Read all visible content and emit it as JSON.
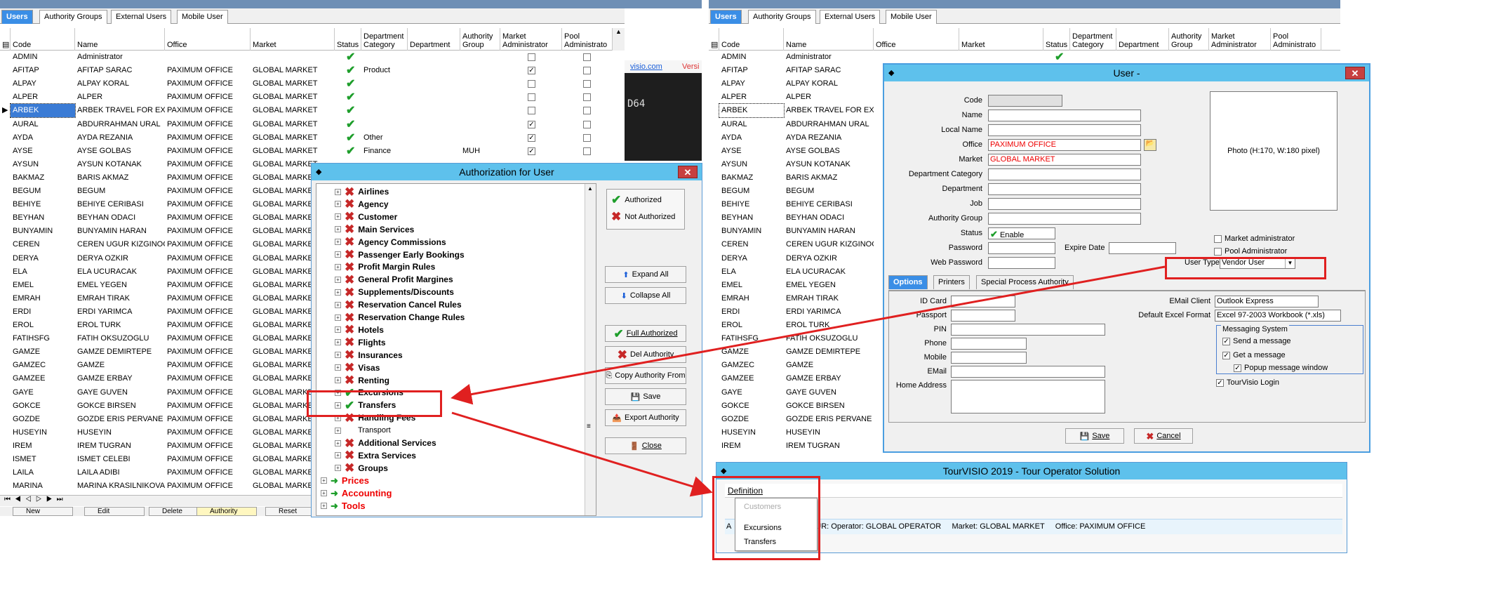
{
  "left_grid": {
    "tabs": [
      "Users",
      "Authority Groups",
      "External Users",
      "Mobile User"
    ],
    "columns": [
      "Code",
      "Name",
      "Office",
      "Market",
      "Status",
      "Department Category",
      "Department",
      "Authority Group",
      "Market Administrator",
      "Pool Administrato"
    ],
    "rows": [
      {
        "code": "ADMIN",
        "name": "Administrator",
        "office": "",
        "market": "",
        "status": true,
        "dept_cat": "",
        "auth_group": "",
        "market_admin": false,
        "pool_admin": false
      },
      {
        "code": "AFITAP",
        "name": "AFITAP SARAC",
        "office": "PAXIMUM OFFICE",
        "market": "GLOBAL MARKET",
        "status": true,
        "dept_cat": "Product",
        "auth_group": "",
        "market_admin": true,
        "pool_admin": false
      },
      {
        "code": "ALPAY",
        "name": "ALPAY KORAL",
        "office": "PAXIMUM OFFICE",
        "market": "GLOBAL MARKET",
        "status": true,
        "dept_cat": "",
        "auth_group": "",
        "market_admin": false,
        "pool_admin": false
      },
      {
        "code": "ALPER",
        "name": "ALPER",
        "office": "PAXIMUM OFFICE",
        "market": "GLOBAL MARKET",
        "status": true,
        "dept_cat": "",
        "auth_group": "",
        "market_admin": false,
        "pool_admin": false
      },
      {
        "code": "ARBEK",
        "name": "ARBEK TRAVEL FOR EXCU",
        "office": "PAXIMUM OFFICE",
        "market": "GLOBAL MARKET",
        "status": true,
        "dept_cat": "",
        "auth_group": "",
        "market_admin": false,
        "pool_admin": false
      },
      {
        "code": "AURAL",
        "name": "ABDURRAHMAN URAL",
        "office": "PAXIMUM OFFICE",
        "market": "GLOBAL MARKET",
        "status": true,
        "dept_cat": "",
        "auth_group": "",
        "market_admin": true,
        "pool_admin": false
      },
      {
        "code": "AYDA",
        "name": "AYDA REZANIA",
        "office": "PAXIMUM OFFICE",
        "market": "GLOBAL MARKET",
        "status": true,
        "dept_cat": "Other",
        "auth_group": "",
        "market_admin": true,
        "pool_admin": false
      },
      {
        "code": "AYSE",
        "name": "AYSE GOLBAS",
        "office": "PAXIMUM OFFICE",
        "market": "GLOBAL MARKET",
        "status": true,
        "dept_cat": "Finance",
        "auth_group": "MUH",
        "market_admin": true,
        "pool_admin": false
      },
      {
        "code": "AYSUN",
        "name": "AYSUN KOTANAK",
        "office": "PAXIMUM OFFICE",
        "market": "GLOBAL MARKET"
      },
      {
        "code": "BAKMAZ",
        "name": "BARIS AKMAZ",
        "office": "PAXIMUM OFFICE",
        "market": "GLOBAL MARKET"
      },
      {
        "code": "BEGUM",
        "name": "BEGUM",
        "office": "PAXIMUM OFFICE",
        "market": "GLOBAL MARKET"
      },
      {
        "code": "BEHIYE",
        "name": "BEHIYE CERIBASI",
        "office": "PAXIMUM OFFICE",
        "market": "GLOBAL MARKET"
      },
      {
        "code": "BEYHAN",
        "name": "BEYHAN ODACI",
        "office": "PAXIMUM OFFICE",
        "market": "GLOBAL MARKET"
      },
      {
        "code": "BUNYAMIN",
        "name": "BUNYAMIN HARAN",
        "office": "PAXIMUM OFFICE",
        "market": "GLOBAL MARKET"
      },
      {
        "code": "CEREN",
        "name": "CEREN UGUR KIZGINOGLU",
        "office": "PAXIMUM OFFICE",
        "market": "GLOBAL MARKET"
      },
      {
        "code": "DERYA",
        "name": "DERYA OZKIR",
        "office": "PAXIMUM OFFICE",
        "market": "GLOBAL MARKET"
      },
      {
        "code": "ELA",
        "name": "ELA UCURACAK",
        "office": "PAXIMUM OFFICE",
        "market": "GLOBAL MARKET"
      },
      {
        "code": "EMEL",
        "name": "EMEL YEGEN",
        "office": "PAXIMUM OFFICE",
        "market": "GLOBAL MARKET"
      },
      {
        "code": "EMRAH",
        "name": "EMRAH TIRAK",
        "office": "PAXIMUM OFFICE",
        "market": "GLOBAL MARKET"
      },
      {
        "code": "ERDI",
        "name": "ERDI YARIMCA",
        "office": "PAXIMUM OFFICE",
        "market": "GLOBAL MARKET"
      },
      {
        "code": "EROL",
        "name": "EROL TURK",
        "office": "PAXIMUM OFFICE",
        "market": "GLOBAL MARKET"
      },
      {
        "code": "FATIHSFG",
        "name": "FATIH OKSUZOGLU",
        "office": "PAXIMUM OFFICE",
        "market": "GLOBAL MARKET"
      },
      {
        "code": "GAMZE",
        "name": "GAMZE DEMIRTEPE",
        "office": "PAXIMUM OFFICE",
        "market": "GLOBAL MARKET"
      },
      {
        "code": "GAMZEC",
        "name": "GAMZE",
        "office": "PAXIMUM OFFICE",
        "market": "GLOBAL MARKET"
      },
      {
        "code": "GAMZEE",
        "name": "GAMZE ERBAY",
        "office": "PAXIMUM OFFICE",
        "market": "GLOBAL MARKET"
      },
      {
        "code": "GAYE",
        "name": "GAYE GUVEN",
        "office": "PAXIMUM OFFICE",
        "market": "GLOBAL MARKET"
      },
      {
        "code": "GOKCE",
        "name": "GOKCE BIRSEN",
        "office": "PAXIMUM OFFICE",
        "market": "GLOBAL MARKET"
      },
      {
        "code": "GOZDE",
        "name": "GOZDE ERIS PERVANE",
        "office": "PAXIMUM OFFICE",
        "market": "GLOBAL MARKET"
      },
      {
        "code": "HUSEYIN",
        "name": "HUSEYIN",
        "office": "PAXIMUM OFFICE",
        "market": "GLOBAL MARKET"
      },
      {
        "code": "IREM",
        "name": "IREM TUGRAN",
        "office": "PAXIMUM OFFICE",
        "market": "GLOBAL MARKET"
      },
      {
        "code": "ISMET",
        "name": "ISMET CELEBI",
        "office": "PAXIMUM OFFICE",
        "market": "GLOBAL MARKET"
      },
      {
        "code": "LAILA",
        "name": "LAILA ADIBI",
        "office": "PAXIMUM OFFICE",
        "market": "GLOBAL MARKET"
      },
      {
        "code": "MARINA",
        "name": "MARINA KRASILNIKOVA",
        "office": "PAXIMUM OFFICE",
        "market": "GLOBAL MARKET"
      }
    ],
    "bottom_buttons": [
      "New",
      "Edit",
      "Delete",
      "Authority",
      "Reset"
    ]
  },
  "background_bits": {
    "link_text": "visio.com",
    "version_text": "Versi",
    "console_text": "D64"
  },
  "auth_dialog": {
    "title": "Authorization for User",
    "items": [
      {
        "label": "Airlines",
        "state": "x"
      },
      {
        "label": "Agency",
        "state": "x"
      },
      {
        "label": "Customer",
        "state": "x"
      },
      {
        "label": "Main Services",
        "state": "x"
      },
      {
        "label": "Agency Commissions",
        "state": "x"
      },
      {
        "label": "Passenger Early Bookings",
        "state": "x"
      },
      {
        "label": "Profit Margin Rules",
        "state": "x"
      },
      {
        "label": "General Profit Margines",
        "state": "x"
      },
      {
        "label": "Supplements/Discounts",
        "state": "x"
      },
      {
        "label": "Reservation Cancel Rules",
        "state": "x"
      },
      {
        "label": "Reservation Change Rules",
        "state": "x"
      },
      {
        "label": "Hotels",
        "state": "x"
      },
      {
        "label": "Flights",
        "state": "x"
      },
      {
        "label": "Insurances",
        "state": "x"
      },
      {
        "label": "Visas",
        "state": "x"
      },
      {
        "label": "Renting",
        "state": "x"
      },
      {
        "label": "Excursions",
        "state": "v"
      },
      {
        "label": "Transfers",
        "state": "v"
      },
      {
        "label": "Handling Fees",
        "state": "x"
      },
      {
        "label": "Transport",
        "state": "none"
      },
      {
        "label": "Additional Services",
        "state": "x"
      },
      {
        "label": "Extra Services",
        "state": "x"
      },
      {
        "label": "Groups",
        "state": "x"
      },
      {
        "label": "Prices",
        "state": "group"
      },
      {
        "label": "Accounting",
        "state": "group"
      },
      {
        "label": "Tools",
        "state": "group"
      }
    ],
    "legend_authorized": "Authorized",
    "legend_not_authorized": "Not Authorized",
    "expand_all": "Expand All",
    "collapse_all": "Collapse All",
    "full_authorized": "Full Authorized",
    "del_authority": "Del Authority",
    "copy_authority": "Copy Authority From",
    "save": "Save",
    "export_authority": "Export Authority",
    "close": "Close"
  },
  "right_grid": {
    "tabs": [
      "Users",
      "Authority Groups",
      "External Users",
      "Mobile User"
    ],
    "columns": [
      "Code",
      "Name",
      "Office",
      "Market",
      "Status",
      "Department Category",
      "Department",
      "Authority Group",
      "Market Administrator",
      "Pool Administrato"
    ],
    "rows": [
      {
        "code": "ADMIN",
        "name": "Administrator"
      },
      {
        "code": "AFITAP",
        "name": "AFITAP SARAC"
      },
      {
        "code": "ALPAY",
        "name": "ALPAY KORAL"
      },
      {
        "code": "ALPER",
        "name": "ALPER"
      },
      {
        "code": "ARBEK",
        "name": "ARBEK TRAVEL FOR EXCU"
      },
      {
        "code": "AURAL",
        "name": "ABDURRAHMAN URAL"
      },
      {
        "code": "AYDA",
        "name": "AYDA REZANIA"
      },
      {
        "code": "AYSE",
        "name": "AYSE GOLBAS"
      },
      {
        "code": "AYSUN",
        "name": "AYSUN KOTANAK"
      },
      {
        "code": "BAKMAZ",
        "name": "BARIS AKMAZ"
      },
      {
        "code": "BEGUM",
        "name": "BEGUM"
      },
      {
        "code": "BEHIYE",
        "name": "BEHIYE CERIBASI"
      },
      {
        "code": "BEYHAN",
        "name": "BEYHAN ODACI"
      },
      {
        "code": "BUNYAMIN",
        "name": "BUNYAMIN HARAN"
      },
      {
        "code": "CEREN",
        "name": "CEREN UGUR KIZGINOGLU"
      },
      {
        "code": "DERYA",
        "name": "DERYA OZKIR"
      },
      {
        "code": "ELA",
        "name": "ELA UCURACAK"
      },
      {
        "code": "EMEL",
        "name": "EMEL YEGEN"
      },
      {
        "code": "EMRAH",
        "name": "EMRAH TIRAK"
      },
      {
        "code": "ERDI",
        "name": "ERDI YARIMCA"
      },
      {
        "code": "EROL",
        "name": "EROL TURK"
      },
      {
        "code": "FATIHSFG",
        "name": "FATIH OKSUZOGLU"
      },
      {
        "code": "GAMZE",
        "name": "GAMZE DEMIRTEPE"
      },
      {
        "code": "GAMZEC",
        "name": "GAMZE"
      },
      {
        "code": "GAMZEE",
        "name": "GAMZE ERBAY"
      },
      {
        "code": "GAYE",
        "name": "GAYE GUVEN"
      },
      {
        "code": "GOKCE",
        "name": "GOKCE BIRSEN"
      },
      {
        "code": "GOZDE",
        "name": "GOZDE ERIS PERVANE"
      },
      {
        "code": "HUSEYIN",
        "name": "HUSEYIN"
      },
      {
        "code": "IREM",
        "name": "IREM TUGRAN"
      }
    ]
  },
  "user_dialog": {
    "title": "User -",
    "labels": {
      "code": "Code",
      "name": "Name",
      "local_name": "Local Name",
      "office": "Office",
      "market": "Market",
      "dept_cat": "Department Category",
      "department": "Department",
      "job": "Job",
      "auth_group": "Authority Group",
      "status": "Status",
      "password": "Password",
      "expire_date": "Expire Date",
      "web_password": "Web Password",
      "user_type": "User Type"
    },
    "office_value": "PAXIMUM OFFICE",
    "market_value": "GLOBAL MARKET",
    "status_value": "Enable",
    "user_type_value": "Vendor User",
    "photo_text": "Photo (H:170, W:180 pixel)",
    "market_admin": "Market administrator",
    "pool_admin": "Pool Administrator",
    "tabs": [
      "Options",
      "Printers",
      "Special Process Authority"
    ],
    "opt_labels": {
      "id_card": "ID Card",
      "passport": "Passport",
      "pin": "PIN",
      "phone": "Phone",
      "mobile": "Mobile",
      "email": "EMail",
      "home_address": "Home Address"
    },
    "email_client_label": "EMail Client",
    "email_client_value": "Outlook Express",
    "excel_label": "Default Excel Format",
    "excel_value": "Excel 97-2003 Workbook (*.xls)",
    "messaging_title": "Messaging System",
    "send_message": "Send a message",
    "get_message": "Get a message",
    "popup_message": "Popup message window",
    "tourvisio_login": "TourVisio Login",
    "save": "Save",
    "cancel": "Cancel"
  },
  "app_window": {
    "title": "TourVISIO 2019 - Tour Operator Solution",
    "menu_definition": "Definition",
    "menu_items": [
      "Customers",
      "Excursions",
      "Transfers"
    ],
    "status_prefix": "A",
    "status_text": "XCUR: Operator: GLOBAL OPERATOR     Market: GLOBAL MARKET     Office: PAXIMUM OFFICE"
  },
  "colors": {
    "accent": "#3a8ee6",
    "titlebar": "#5ec1ec",
    "annotation": "#e02020",
    "check": "#1e9e2b",
    "cross": "#c62828"
  }
}
